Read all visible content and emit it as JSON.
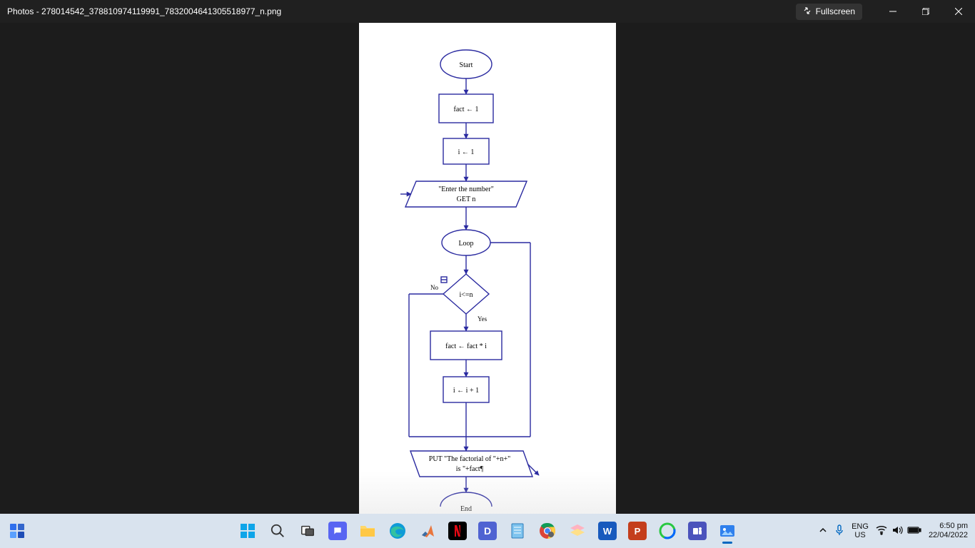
{
  "titlebar": {
    "app_prefix": "Photos - ",
    "filename": "278014542_378810974119991_7832004641305518977_n.png",
    "fullscreen_label": "Fullscreen"
  },
  "flowchart": {
    "start": "Start",
    "step1": "fact ← 1",
    "step2": "i ← 1",
    "input_line1": "\"Enter the number\"",
    "input_line2": "GET n",
    "loop": "Loop",
    "decision": "i<=n",
    "no": "No",
    "yes": "Yes",
    "step3": "fact ← fact * i",
    "step4": "i ← i + 1",
    "output_line1": "PUT \"The factorial of \"+n+\"",
    "output_line2": "is \"+fact¶",
    "end": "End"
  },
  "taskbar": {
    "lang_top": "ENG",
    "lang_bottom": "US",
    "time": "6:50 pm",
    "date": "22/04/2022"
  }
}
